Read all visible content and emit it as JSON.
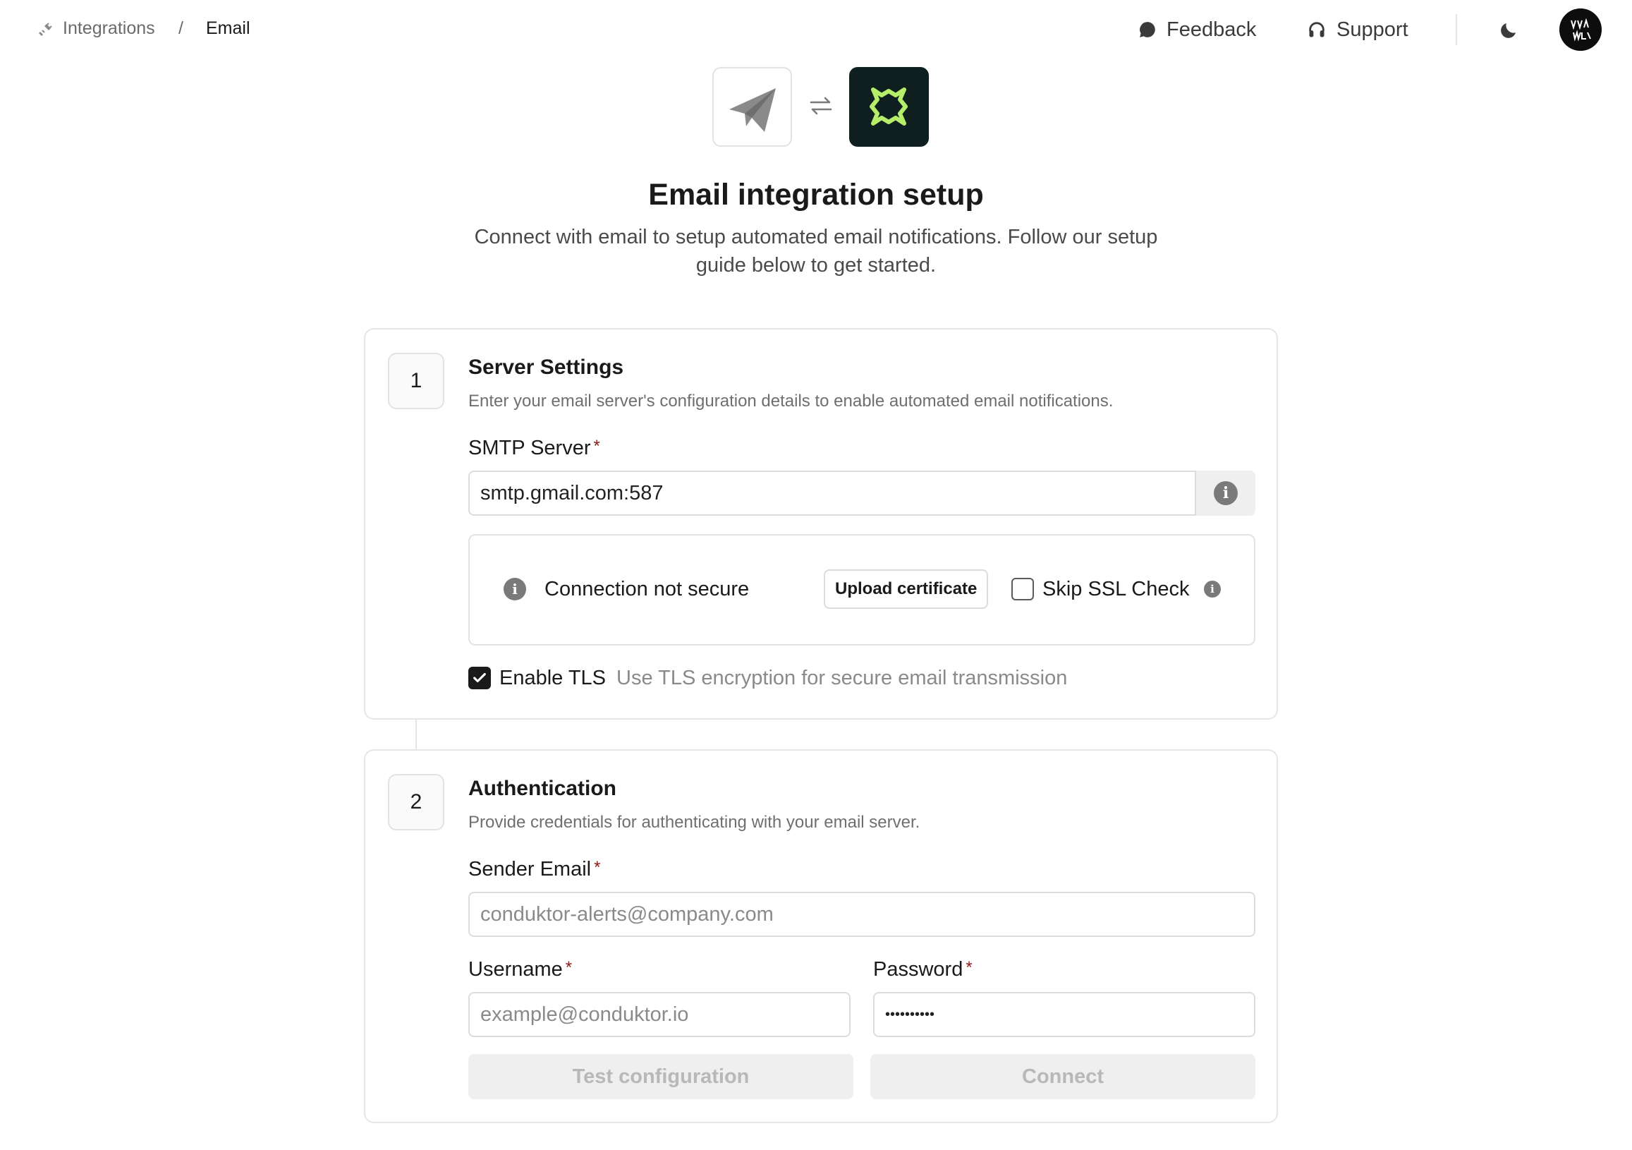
{
  "breadcrumb": {
    "parent": "Integrations",
    "separator": "/",
    "current": "Email"
  },
  "header": {
    "feedback_label": "Feedback",
    "support_label": "Support",
    "avatar_text": "YAVA LAVNDI"
  },
  "hero": {
    "title": "Email integration setup",
    "subtitle": "Connect with email to setup automated email notifications. Follow our setup guide below to get started."
  },
  "server_settings": {
    "step": "1",
    "title": "Server Settings",
    "description": "Enter your email server's configuration details to enable automated email notifications.",
    "smtp_label": "SMTP Server",
    "required_mark": "*",
    "smtp_value": "smtp.gmail.com:587",
    "security_status": "Connection not secure",
    "upload_certificate_label": "Upload certificate",
    "skip_ssl_label": "Skip SSL Check",
    "skip_ssl_checked": false,
    "tls_label": "Enable TLS",
    "tls_description": "Use TLS encryption for secure email transmission",
    "tls_checked": true
  },
  "authentication": {
    "step": "2",
    "title": "Authentication",
    "description": "Provide credentials for authenticating with your email server.",
    "sender_email_label": "Sender Email",
    "sender_email_placeholder": "conduktor-alerts@company.com",
    "username_label": "Username",
    "username_placeholder": "example@conduktor.io",
    "password_label": "Password",
    "password_value": "••••••••••",
    "test_button_label": "Test configuration",
    "connect_button_label": "Connect"
  },
  "colors": {
    "accent_dark": "#1a1a1a",
    "logo_right_bg": "#0f1f1f",
    "logo_right_glyph": "#b5ef6a",
    "required": "#8b1a1a"
  },
  "icons": {
    "breadcrumb": "plug-icon",
    "feedback": "chat-bubble-icon",
    "support": "headphones-icon",
    "theme": "moon-icon",
    "email": "paper-plane-icon",
    "swap": "swap-arrows-icon",
    "conduktor": "conduktor-logo-icon",
    "info": "info-icon"
  }
}
